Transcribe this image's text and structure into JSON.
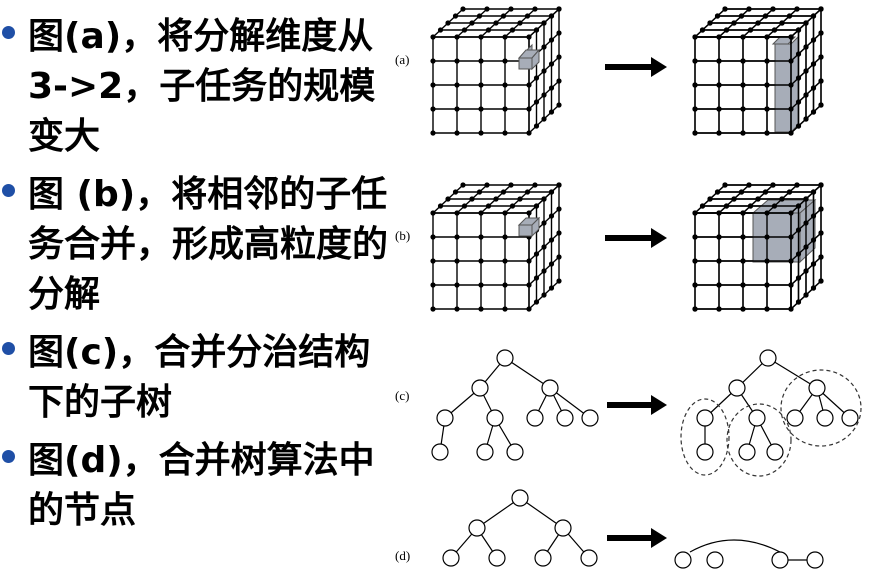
{
  "bullets": [
    {
      "text": "图(a)，将分解维度从 3->2，子任务的规模变大"
    },
    {
      "text": "图 (b)，将相邻的子任务合并，形成高粒度的分解"
    },
    {
      "text": "图(c)，合并分治结构下的子树"
    },
    {
      "text": "图(d)，合并树算法中的节点"
    }
  ],
  "figure": {
    "labels": {
      "a": "(a)",
      "b": "(b)",
      "c": "(c)",
      "d": "(d)"
    },
    "colors": {
      "highlight": "#a7adb8",
      "line": "#000000",
      "arrow": "#000000"
    }
  }
}
